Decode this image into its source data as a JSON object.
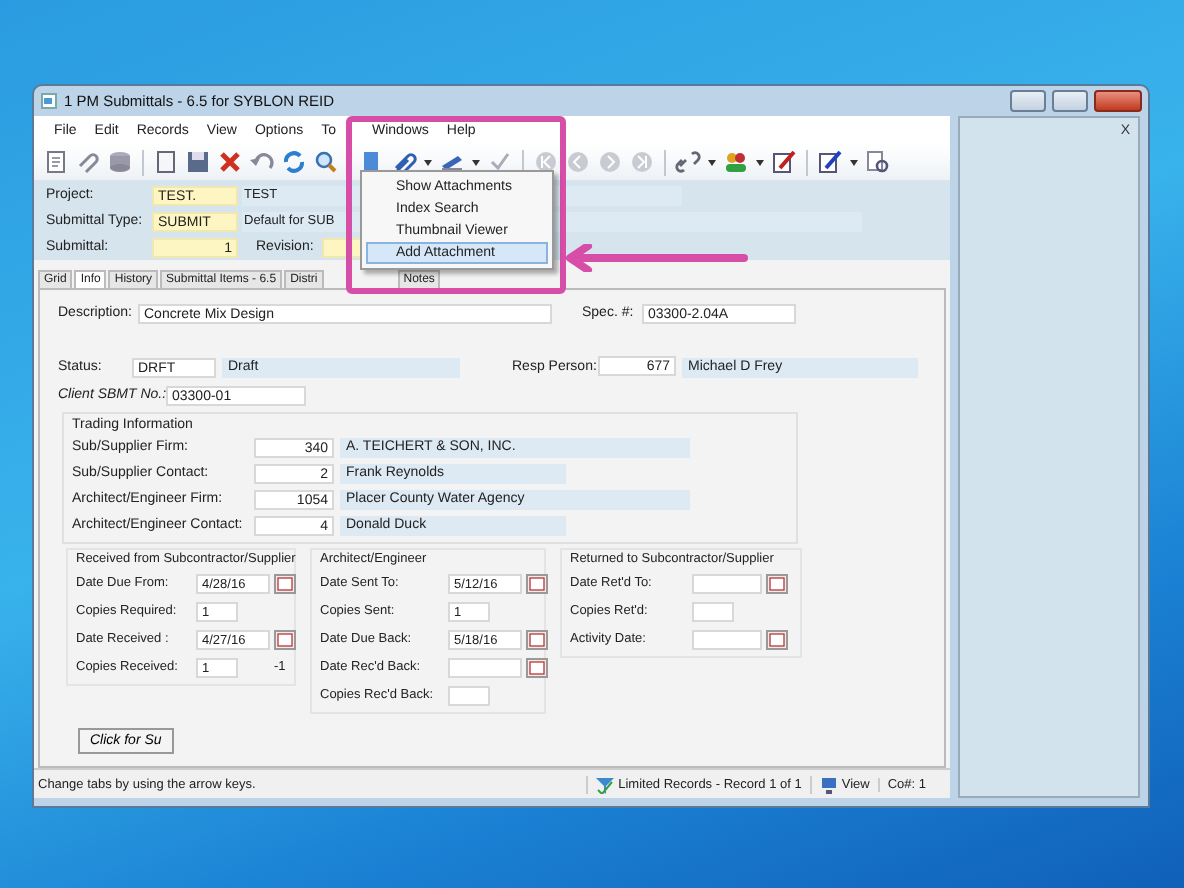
{
  "window": {
    "title": "1 PM Submittals - 6.5 for SYBLON REID"
  },
  "menu": [
    "File",
    "Edit",
    "Records",
    "View",
    "Options",
    "To",
    "Windows",
    "Help"
  ],
  "attachment_menu": [
    {
      "label": "Show Attachments",
      "selected": false
    },
    {
      "label": "Index Search",
      "selected": false
    },
    {
      "label": "Thumbnail Viewer",
      "selected": false
    },
    {
      "label": "Add Attachment",
      "selected": true
    }
  ],
  "header": {
    "project": {
      "label": "Project:",
      "code": "TEST.",
      "name": "TEST"
    },
    "submittal_type": {
      "label": "Submittal Type:",
      "code": "SUBMIT",
      "name": "Default for SUB"
    },
    "submittal": {
      "label": "Submittal:",
      "code": "1"
    },
    "revision": {
      "label": "Revision:"
    }
  },
  "tabs": [
    {
      "label": "Grid",
      "selected": false
    },
    {
      "label": "Info",
      "selected": true
    },
    {
      "label": "History",
      "selected": false
    },
    {
      "label": "Submittal Items - 6.5",
      "selected": false
    },
    {
      "label": "Distri",
      "selected": false
    },
    {
      "label": "Notes",
      "selected": false
    }
  ],
  "info": {
    "description": {
      "label": "Description:",
      "value": "Concrete Mix Design"
    },
    "spec": {
      "label": "Spec. #:",
      "value": "03300-2.04A"
    },
    "status": {
      "label": "Status:",
      "code": "DRFT",
      "name": "Draft"
    },
    "resp_person": {
      "label": "Resp Person:",
      "code": "677",
      "name": "Michael D Frey"
    },
    "client_sbmt": {
      "label": "Client SBMT No.:",
      "value": "03300-01"
    }
  },
  "trading": {
    "title": "Trading Information",
    "rows": [
      {
        "label": "Sub/Supplier Firm:",
        "code": "340",
        "name": "A. TEICHERT & SON, INC."
      },
      {
        "label": "Sub/Supplier Contact:",
        "code": "2",
        "name": "Frank   Reynolds"
      },
      {
        "label": "Architect/Engineer Firm:",
        "code": "1054",
        "name": "Placer County Water Agency"
      },
      {
        "label": "Architect/Engineer Contact:",
        "code": "4",
        "name": "Donald   Duck"
      }
    ]
  },
  "groups": [
    {
      "title": "Received from Subcontractor/Supplier",
      "rows": [
        {
          "kind": "date",
          "label": "Date Due From:",
          "value": "4/28/16"
        },
        {
          "kind": "count",
          "label": "Copies Required:",
          "value": "1"
        },
        {
          "kind": "date",
          "label": "Date Received :",
          "value": "4/27/16"
        },
        {
          "kind": "count",
          "label": "Copies Received:",
          "value": "1",
          "note": "-1"
        }
      ]
    },
    {
      "title": "Architect/Engineer",
      "rows": [
        {
          "kind": "date",
          "label": "Date Sent To:",
          "value": "5/12/16"
        },
        {
          "kind": "count",
          "label": "Copies Sent:",
          "value": "1"
        },
        {
          "kind": "date",
          "label": "Date Due Back:",
          "value": "5/18/16"
        },
        {
          "kind": "date",
          "label": "Date Rec'd Back:"
        },
        {
          "kind": "count",
          "label": "Copies Rec'd Back:"
        }
      ]
    },
    {
      "title": "Returned to Subcontractor/Supplier",
      "rows": [
        {
          "kind": "date",
          "label": "Date Ret'd To:"
        },
        {
          "kind": "count",
          "label": "Copies Ret'd:"
        },
        {
          "kind": "date",
          "label": "Activity Date:"
        }
      ]
    }
  ],
  "button": "Click for Su",
  "status_bar": {
    "message": "Change tabs by using the arrow keys.",
    "records": "Limited Records - Record 1 of 1",
    "mode": "View",
    "company": "Co#: 1"
  },
  "side_panel": {
    "close": "X"
  }
}
